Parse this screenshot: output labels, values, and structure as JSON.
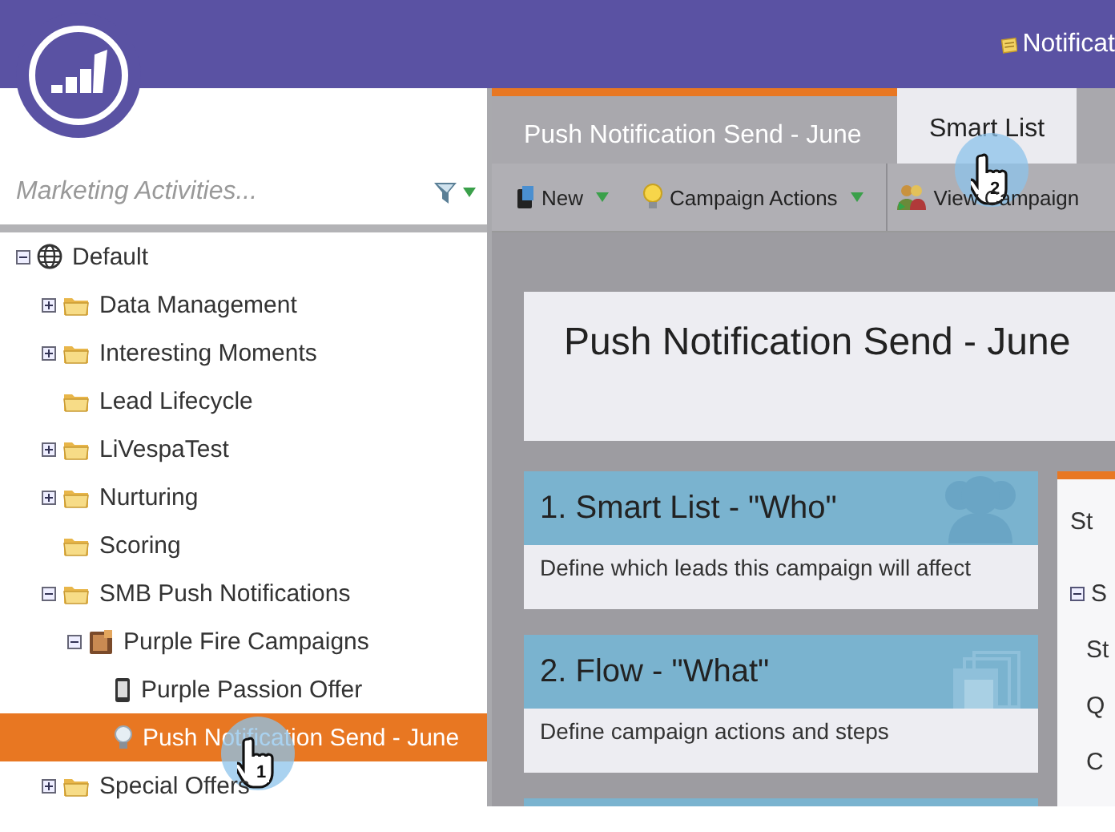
{
  "header": {
    "notice": "Notificat"
  },
  "search": {
    "placeholder": "Marketing Activities..."
  },
  "tree": [
    {
      "label": "Default",
      "kind": "globe",
      "expanded": true,
      "selected": false,
      "children": [
        {
          "label": "Data Management",
          "kind": "folder",
          "expanded": false,
          "selected": false
        },
        {
          "label": "Interesting Moments",
          "kind": "folder",
          "expanded": false,
          "selected": false
        },
        {
          "label": "Lead Lifecycle",
          "kind": "folder",
          "selected": false
        },
        {
          "label": "LiVespaTest",
          "kind": "folder",
          "expanded": false,
          "selected": false
        },
        {
          "label": "Nurturing",
          "kind": "folder",
          "expanded": false,
          "selected": false
        },
        {
          "label": "Scoring",
          "kind": "folder",
          "selected": false
        },
        {
          "label": "SMB Push Notifications",
          "kind": "folder",
          "expanded": true,
          "selected": false,
          "children": [
            {
              "label": "Purple Fire Campaigns",
              "kind": "program",
              "expanded": true,
              "selected": false,
              "children": [
                {
                  "label": "Purple Passion Offer",
                  "kind": "mobile",
                  "selected": false
                },
                {
                  "label": "Push Notification Send - June",
                  "kind": "campaign",
                  "selected": true
                }
              ]
            }
          ]
        },
        {
          "label": "Special Offers",
          "kind": "folder",
          "expanded": false,
          "selected": false
        }
      ]
    }
  ],
  "tabs": [
    {
      "label": "Push Notification Send - June",
      "selected": false
    },
    {
      "label": "Smart List",
      "selected": true
    }
  ],
  "toolbar": [
    {
      "label": "New",
      "kind": "book",
      "menu": true
    },
    {
      "label": "Campaign Actions",
      "kind": "bulb",
      "menu": true
    },
    {
      "label": "View Campaign",
      "kind": "people",
      "menu": false
    }
  ],
  "title": "Push Notification Send - June",
  "cards": [
    {
      "title": "1. Smart List - \"Who\"",
      "description": "Define which leads this campaign will affect",
      "kind": "people"
    },
    {
      "title": "2. Flow - \"What\"",
      "description": "Define campaign actions and steps",
      "kind": "stack"
    }
  ],
  "status_panel": {
    "title": "St",
    "section": {
      "label": "S",
      "expanded": true
    },
    "fields": [
      "St",
      "Q",
      "C"
    ]
  },
  "callouts": [
    {
      "number": "1"
    },
    {
      "number": "2"
    }
  ]
}
